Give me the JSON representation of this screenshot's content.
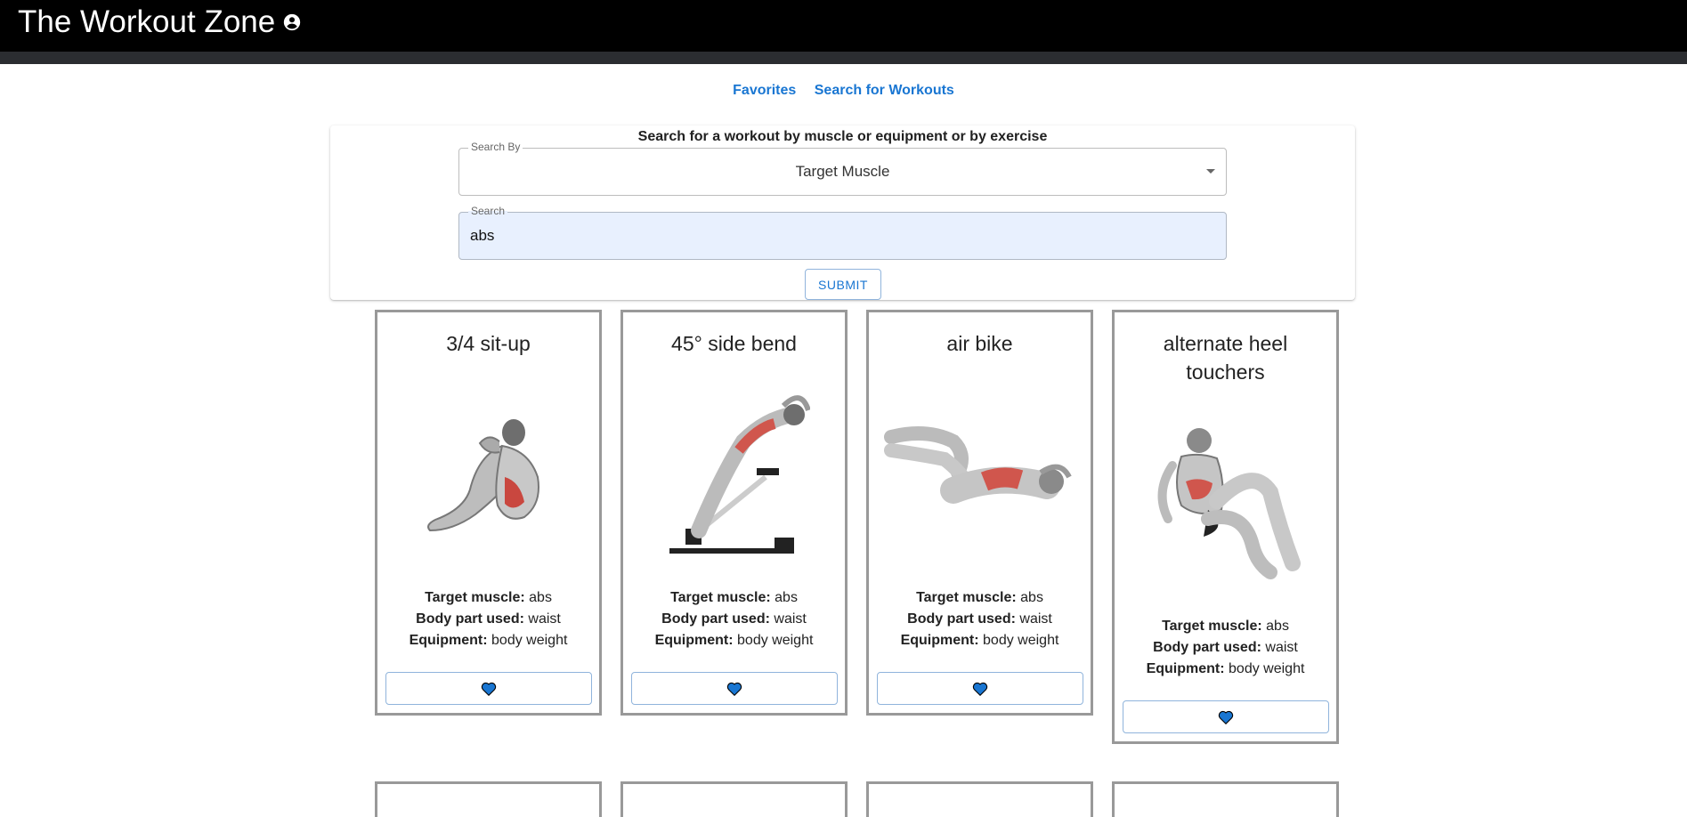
{
  "app": {
    "title": "The Workout Zone",
    "account_icon": "account-circle-icon"
  },
  "nav": {
    "favorites": "Favorites",
    "search": "Search for Workouts"
  },
  "search": {
    "heading": "Search for a workout by muscle or equipment or by exercise",
    "search_by_label": "Search By",
    "search_by_value": "Target Muscle",
    "search_label": "Search",
    "search_value": "abs",
    "submit": "SUBMIT"
  },
  "labels": {
    "target": "Target muscle:",
    "body": "Body part used:",
    "equipment": "Equipment:"
  },
  "accent_color": "#1976d2",
  "cards": [
    {
      "name": "3/4 sit-up",
      "target": "abs",
      "body": "waist",
      "equipment": "body weight"
    },
    {
      "name": "45° side bend",
      "target": "abs",
      "body": "waist",
      "equipment": "body weight"
    },
    {
      "name": "air bike",
      "target": "abs",
      "body": "waist",
      "equipment": "body weight"
    },
    {
      "name": "alternate heel touchers",
      "target": "abs",
      "body": "waist",
      "equipment": "body weight"
    }
  ]
}
